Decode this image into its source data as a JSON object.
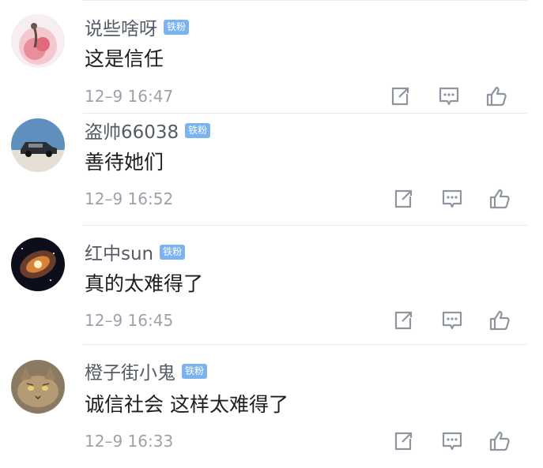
{
  "badge_label": "铁粉",
  "colors": {
    "badge": "#7ab3ee",
    "username": "#555b66",
    "timestamp": "#9da2aa",
    "icon": "#8f959e"
  },
  "icons": {
    "repost": "external-link-icon",
    "reply": "chat-bubble-icon",
    "like": "thumbs-up-icon"
  },
  "comments": [
    {
      "username": "说些啥呀",
      "content": "这是信任",
      "timestamp": "12–9 16:47",
      "avatar": "pink-floral-avatar"
    },
    {
      "username": "盗帅66038",
      "content": "善待她们",
      "timestamp": "12–9 16:52",
      "avatar": "car-desert-avatar"
    },
    {
      "username": "红中sun",
      "content": "真的太难得了",
      "timestamp": "12–9 16:45",
      "avatar": "galaxy-avatar"
    },
    {
      "username": "橙子街小鬼",
      "content": "诚信社会 这样太难得了",
      "timestamp": "12–9 16:33",
      "avatar": "cat-avatar"
    }
  ]
}
